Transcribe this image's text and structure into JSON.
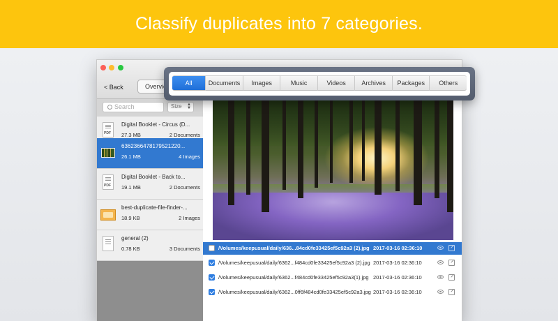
{
  "banner": {
    "text": "Classify duplicates into 7 categories."
  },
  "toolbar": {
    "back_label": "< Back",
    "overview_label": "Overview"
  },
  "sidebar": {
    "search_placeholder": "Search",
    "sort_label": "Size",
    "items": [
      {
        "name": "Digital Booklet - Circus (D...",
        "size": "27.3 MB",
        "count": "2 Documents",
        "icon": "pdf-document-icon"
      },
      {
        "name": "6362366478179521220...",
        "size": "26.1 MB",
        "count": "4 Images",
        "icon": "image-thumbnail-icon"
      },
      {
        "name": "Digital Booklet - Back to...",
        "size": "19.1 MB",
        "count": "2 Documents",
        "icon": "pdf-document-icon"
      },
      {
        "name": "best-duplicate-file-finder-...",
        "size": "18.9 KB",
        "count": "2 Images",
        "icon": "image-thumbnail-icon"
      },
      {
        "name": "general (2)",
        "size": "0.78 KB",
        "count": "3 Documents",
        "icon": "document-icon"
      }
    ]
  },
  "categories": [
    "All",
    "Documents",
    "Images",
    "Music",
    "Videos",
    "Archives",
    "Packages",
    "Others"
  ],
  "active_category": "All",
  "files": [
    {
      "path": "/Volumes/keepusual/daily/636...84cd0fe33425ef5c92a3  (2).jpg",
      "date": "2017-03-16 02:36:10",
      "checked": false,
      "selected": true
    },
    {
      "path": "/Volumes/keepusual/daily/6362...f484cd0fe33425ef5c92a3 (2).jpg",
      "date": "2017-03-16 02:36:10",
      "checked": true,
      "selected": false
    },
    {
      "path": "/Volumes/keepusual/daily/6362...f484cd0fe33425ef5c92a3(1).jpg",
      "date": "2017-03-16 02:36:10",
      "checked": true,
      "selected": false
    },
    {
      "path": "/Volumes/keepusual/daily/6362...0ff6f484cd0fe33425ef5c92a3.jpg",
      "date": "2017-03-16 02:36:10",
      "checked": true,
      "selected": false
    }
  ],
  "colors": {
    "banner": "#fdc50d",
    "accent": "#3279d0",
    "sidebar": "#8e8e8e"
  }
}
